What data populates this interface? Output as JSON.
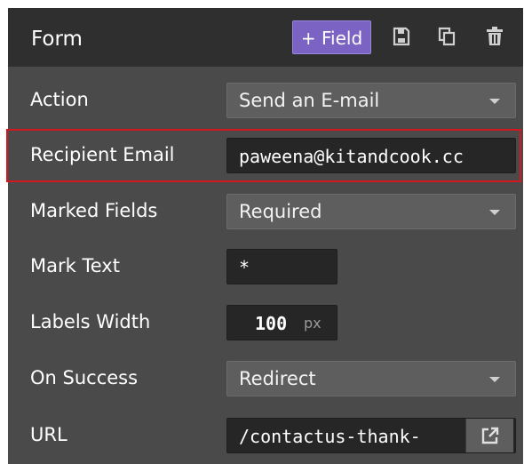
{
  "header": {
    "title": "Form",
    "add_field_label": "+ Field",
    "icons": [
      "save-icon",
      "duplicate-icon",
      "trash-icon"
    ]
  },
  "colors": {
    "panel": "#4a4a4a",
    "header": "#2f2f2f",
    "accent": "#7a63c2",
    "highlight": "#d4161d"
  },
  "fields": {
    "action": {
      "label": "Action",
      "value": "Send an E-mail"
    },
    "recipient_email": {
      "label": "Recipient Email",
      "value": "paweena@kitandcook.cc"
    },
    "marked_fields": {
      "label": "Marked Fields",
      "value": "Required"
    },
    "mark_text": {
      "label": "Mark Text",
      "value": "*"
    },
    "labels_width": {
      "label": "Labels Width",
      "value": "100",
      "unit": "px"
    },
    "on_success": {
      "label": "On Success",
      "value": "Redirect"
    },
    "url": {
      "label": "URL",
      "value": "/contactus-thank-",
      "button_icon": "external-link-icon"
    }
  }
}
